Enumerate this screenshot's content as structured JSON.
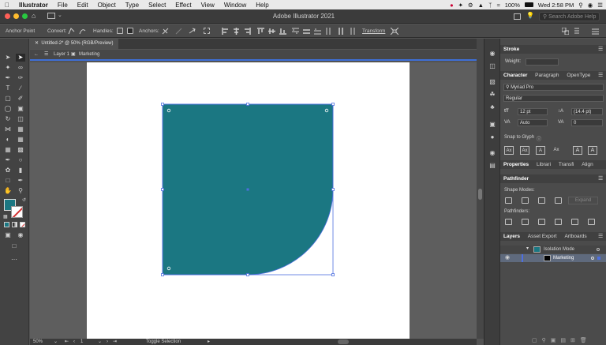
{
  "menubar": {
    "app_name": "Illustrator",
    "items": [
      "File",
      "Edit",
      "Object",
      "Type",
      "Select",
      "Effect",
      "View",
      "Window",
      "Help"
    ],
    "battery": "100%",
    "datetime": "Wed 2:58 PM"
  },
  "window": {
    "title": "Adobe Illustrator 2021",
    "search_placeholder": "Search Adobe Help"
  },
  "controlbar": {
    "mode_label": "Anchor Point",
    "convert_label": "Convert:",
    "handles_label": "Handles:",
    "anchors_label": "Anchors:",
    "transform_label": "Transform"
  },
  "document": {
    "tab_title": "Untitled-2* @ 50% (RGB/Preview)",
    "crumb_layer": "Layer 1",
    "crumb_group": "Marketing"
  },
  "bottombar": {
    "zoom": "50%",
    "artboard_number": "1",
    "status_text": "Toggle Selection"
  },
  "colors": {
    "fill": "#1b7782",
    "stroke": "#d33131",
    "selection": "#4d6fe0"
  },
  "panels": {
    "stroke": {
      "title": "Stroke",
      "weight_label": "Weight:"
    },
    "character": {
      "tabs": [
        "Character",
        "Paragraph",
        "OpenType"
      ],
      "font_family": "Myriad Pro",
      "font_style": "Regular",
      "font_size": "12 pt",
      "leading": "(14.4 pt)",
      "kerning": "Auto",
      "tracking": "0",
      "snap_label": "Snap to Glyph"
    },
    "properties_tabs": [
      "Properties",
      "Librari",
      "Transfi",
      "Align"
    ],
    "pathfinder": {
      "title": "Pathfinder",
      "shape_modes_label": "Shape Modes:",
      "expand_label": "Expand",
      "pathfinders_label": "Pathfinders:"
    },
    "layers": {
      "tabs": [
        "Layers",
        "Asset Export",
        "Artboards"
      ],
      "isolation_label": "Isolation Mode",
      "layer_name": "Marketing"
    }
  }
}
